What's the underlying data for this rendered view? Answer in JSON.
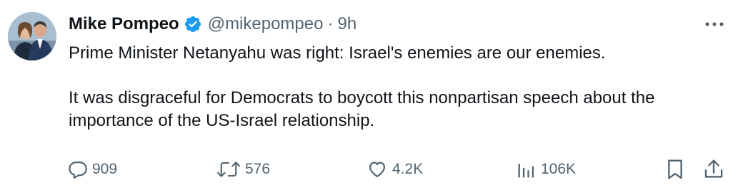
{
  "author": {
    "name": "Mike Pompeo",
    "handle": "@mikepompeo",
    "separator": "·",
    "time": "9h",
    "verified": true
  },
  "tweet": {
    "paragraphs": [
      "Prime Minister Netanyahu was right: Israel's enemies are our enemies.",
      "It was disgraceful for Democrats to boycott this nonpartisan speech about the importance of the US-Israel relationship."
    ]
  },
  "actions": {
    "replies": "909",
    "retweets": "576",
    "likes": "4.2K",
    "views": "106K"
  },
  "icons": {
    "verified": "verified-badge-icon",
    "more": "more-dots-icon",
    "reply": "reply-icon",
    "retweet": "retweet-icon",
    "like": "heart-icon",
    "views": "views-bar-chart-icon",
    "bookmark": "bookmark-icon",
    "share": "share-icon"
  },
  "colors": {
    "text": "#0f1419",
    "secondary": "#536471",
    "verified": "#1d9bf0"
  }
}
